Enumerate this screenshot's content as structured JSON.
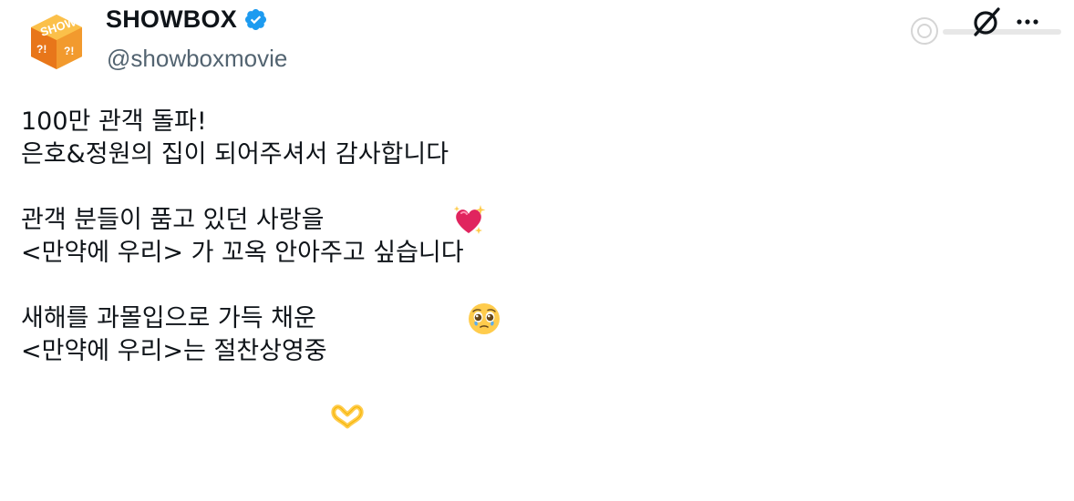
{
  "author": {
    "display_name": "SHOWBOX",
    "handle": "@showboxmovie",
    "avatar_text": "SHOWBOX",
    "verified_icon": "verified-badge-icon"
  },
  "header_icons": [
    "grok-icon",
    "more-options-icon"
  ],
  "watermark_icon": "watermark-logo-icon",
  "post": {
    "lines": [
      "100만 관객 돌파!",
      "은호&정원의 집이 되어주셔서 감사합니다",
      "",
      "관객 분들이 품고 있던 사랑을",
      "<만약에 우리> 가 꼬옥 안아주고 싶습니다",
      "",
      "새해를 과몰입으로 가득 채운",
      "<만약에 우리>는 절찬상영중"
    ],
    "emojis": [
      "sparkling-heart-emoji",
      "pleading-face-emoji",
      "heart-hands-emoji"
    ]
  },
  "colors": {
    "accent_blue": "#1d9bf0",
    "text_primary": "#0f1419",
    "text_secondary": "#536471",
    "avatar_orange": "#f08a1c"
  }
}
